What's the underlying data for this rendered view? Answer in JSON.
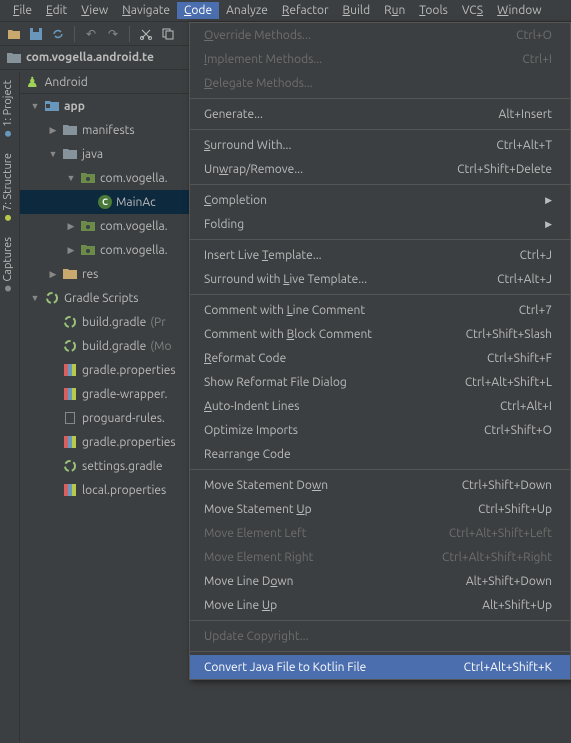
{
  "menubar": {
    "items": [
      {
        "label": "File",
        "u": 0
      },
      {
        "label": "Edit",
        "u": 0
      },
      {
        "label": "View",
        "u": 0
      },
      {
        "label": "Navigate",
        "u": 0
      },
      {
        "label": "Code",
        "u": 0,
        "active": true
      },
      {
        "label": "Analyze",
        "u": -1
      },
      {
        "label": "Refactor",
        "u": 0
      },
      {
        "label": "Build",
        "u": 0
      },
      {
        "label": "Run",
        "u": 1
      },
      {
        "label": "Tools",
        "u": 0
      },
      {
        "label": "VCS",
        "u": 2
      },
      {
        "label": "Window",
        "u": 0
      }
    ]
  },
  "toolbar": {
    "icons": [
      "open-icon",
      "save-icon",
      "sync-icon",
      "sep",
      "undo-icon",
      "redo-icon",
      "sep",
      "cut-icon",
      "copy-icon"
    ]
  },
  "breadcrumb": {
    "text": "com.vogella.android.te"
  },
  "sideTabs": [
    {
      "label": "1: Project",
      "color": "#6897bb"
    },
    {
      "label": "7: Structure",
      "color": "#b9ca4a"
    },
    {
      "label": "Captures",
      "color": "#888"
    }
  ],
  "projectHead": "Android",
  "tree": [
    {
      "indent": 10,
      "arrow": "down",
      "icon": "module",
      "label": "app",
      "bold": true
    },
    {
      "indent": 28,
      "arrow": "right",
      "icon": "folder",
      "label": "manifests"
    },
    {
      "indent": 28,
      "arrow": "down",
      "icon": "folder",
      "label": "java"
    },
    {
      "indent": 46,
      "arrow": "down",
      "icon": "pkg",
      "label": "com.vogella."
    },
    {
      "indent": 64,
      "arrow": "",
      "icon": "class",
      "label": "MainAc",
      "selected": true
    },
    {
      "indent": 46,
      "arrow": "right",
      "icon": "pkg",
      "label": "com.vogella."
    },
    {
      "indent": 46,
      "arrow": "right",
      "icon": "pkg",
      "label": "com.vogella."
    },
    {
      "indent": 28,
      "arrow": "right",
      "icon": "res",
      "label": "res"
    },
    {
      "indent": 10,
      "arrow": "down",
      "icon": "gradle",
      "label": "Gradle Scripts"
    },
    {
      "indent": 28,
      "arrow": "",
      "icon": "gradle-spin",
      "label": "build.gradle",
      "suffix": "(Pr"
    },
    {
      "indent": 28,
      "arrow": "",
      "icon": "gradle-spin",
      "label": "build.gradle",
      "suffix": "(Mo"
    },
    {
      "indent": 28,
      "arrow": "",
      "icon": "props",
      "label": "gradle.properties"
    },
    {
      "indent": 28,
      "arrow": "",
      "icon": "props",
      "label": "gradle-wrapper."
    },
    {
      "indent": 28,
      "arrow": "",
      "icon": "file",
      "label": "proguard-rules."
    },
    {
      "indent": 28,
      "arrow": "",
      "icon": "props",
      "label": "gradle.properties"
    },
    {
      "indent": 28,
      "arrow": "",
      "icon": "gradle-spin",
      "label": "settings.gradle"
    },
    {
      "indent": 28,
      "arrow": "",
      "icon": "props",
      "label": "local.properties"
    }
  ],
  "dropdown": [
    {
      "label": "Override Methods...",
      "u": 0,
      "shortcut": "Ctrl+O",
      "disabled": true
    },
    {
      "label": "Implement Methods...",
      "u": 0,
      "shortcut": "Ctrl+I",
      "disabled": true
    },
    {
      "label": "Delegate Methods...",
      "u": 0,
      "disabled": true
    },
    {
      "sep": true
    },
    {
      "label": "Generate...",
      "shortcut": "Alt+Insert"
    },
    {
      "sep": true
    },
    {
      "label": "Surround With...",
      "u": 0,
      "shortcut": "Ctrl+Alt+T"
    },
    {
      "label": "Unwrap/Remove...",
      "u": 2,
      "shortcut": "Ctrl+Shift+Delete"
    },
    {
      "sep": true
    },
    {
      "label": "Completion",
      "u": 0,
      "submenu": true
    },
    {
      "label": "Folding",
      "submenu": true
    },
    {
      "sep": true
    },
    {
      "label": "Insert Live Template...",
      "u": 12,
      "shortcut": "Ctrl+J"
    },
    {
      "label": "Surround with Live Template...",
      "u": 14,
      "shortcut": "Ctrl+Alt+J"
    },
    {
      "sep": true
    },
    {
      "label": "Comment with Line Comment",
      "u": 13,
      "shortcut": "Ctrl+7"
    },
    {
      "label": "Comment with Block Comment",
      "u": 13,
      "shortcut": "Ctrl+Shift+Slash"
    },
    {
      "label": "Reformat Code",
      "u": 0,
      "shortcut": "Ctrl+Shift+F"
    },
    {
      "label": "Show Reformat File Dialog",
      "shortcut": "Ctrl+Alt+Shift+L"
    },
    {
      "label": "Auto-Indent Lines",
      "u": 0,
      "shortcut": "Ctrl+Alt+I"
    },
    {
      "label": "Optimize Imports",
      "shortcut": "Ctrl+Shift+O"
    },
    {
      "label": "Rearrange Code"
    },
    {
      "sep": true
    },
    {
      "label": "Move Statement Down",
      "u": 17,
      "shortcut": "Ctrl+Shift+Down"
    },
    {
      "label": "Move Statement Up",
      "u": 15,
      "shortcut": "Ctrl+Shift+Up"
    },
    {
      "label": "Move Element Left",
      "shortcut": "Ctrl+Alt+Shift+Left",
      "disabled": true
    },
    {
      "label": "Move Element Right",
      "shortcut": "Ctrl+Alt+Shift+Right",
      "disabled": true
    },
    {
      "label": "Move Line Down",
      "u": 11,
      "shortcut": "Alt+Shift+Down"
    },
    {
      "label": "Move Line Up",
      "u": 10,
      "shortcut": "Alt+Shift+Up"
    },
    {
      "sep": true
    },
    {
      "label": "Update Copyright...",
      "disabled": true
    },
    {
      "sep": true
    },
    {
      "label": "Convert Java File to Kotlin File",
      "shortcut": "Ctrl+Alt+Shift+K",
      "highlight": true
    }
  ]
}
